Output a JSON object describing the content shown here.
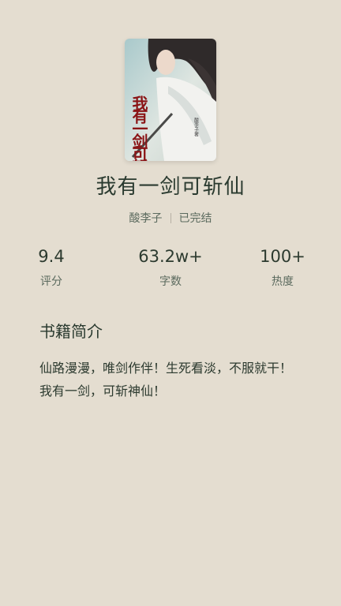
{
  "book": {
    "title": "我有一剑可斩仙",
    "author": "酸李子",
    "status": "已完结",
    "cover_text": "我有一剑可斩仙",
    "cover_author": "酸李子著"
  },
  "stats": [
    {
      "value": "9.4",
      "label": "评分"
    },
    {
      "value": "63.2w+",
      "label": "字数"
    },
    {
      "value": "100+",
      "label": "热度"
    }
  ],
  "intro": {
    "heading": "书籍简介",
    "text": "仙路漫漫，唯剑作伴！生死看淡，不服就干！我有一剑，可斩神仙！"
  },
  "colors": {
    "background": "#e4ddd0",
    "text": "#2c3a2f",
    "muted": "#5b6a5e"
  }
}
